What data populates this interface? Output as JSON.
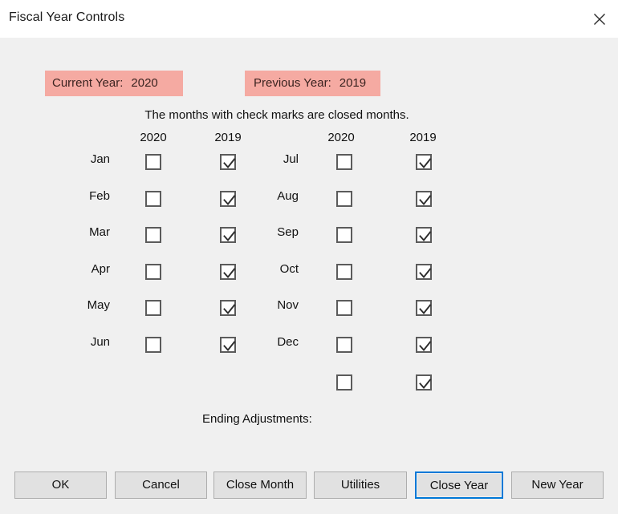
{
  "window": {
    "title": "Fiscal Year Controls",
    "close_icon": "close-icon"
  },
  "header": {
    "current_year_label": "Current Year:",
    "current_year_value": "2020",
    "previous_year_label": "Previous Year:",
    "previous_year_value": "2019",
    "highlight_color": "#f5aaa2",
    "instruction": "The months with check marks are closed months."
  },
  "grid": {
    "column_headers": [
      "2020",
      "2019",
      "2020",
      "2019"
    ],
    "left_rows": [
      {
        "month": "Jan",
        "current_checked": false,
        "previous_checked": true
      },
      {
        "month": "Feb",
        "current_checked": false,
        "previous_checked": true
      },
      {
        "month": "Mar",
        "current_checked": false,
        "previous_checked": true
      },
      {
        "month": "Apr",
        "current_checked": false,
        "previous_checked": true
      },
      {
        "month": "May",
        "current_checked": false,
        "previous_checked": true
      },
      {
        "month": "Jun",
        "current_checked": false,
        "previous_checked": true
      }
    ],
    "right_rows": [
      {
        "month": "Jul",
        "current_checked": false,
        "previous_checked": true
      },
      {
        "month": "Aug",
        "current_checked": false,
        "previous_checked": true
      },
      {
        "month": "Sep",
        "current_checked": false,
        "previous_checked": true
      },
      {
        "month": "Oct",
        "current_checked": false,
        "previous_checked": true
      },
      {
        "month": "Nov",
        "current_checked": false,
        "previous_checked": true
      },
      {
        "month": "Dec",
        "current_checked": false,
        "previous_checked": true
      }
    ],
    "ending_adjustments": {
      "label": "Ending Adjustments:",
      "current_checked": false,
      "previous_checked": true
    }
  },
  "buttons": [
    {
      "label": "OK",
      "focused": false
    },
    {
      "label": "Cancel",
      "focused": false
    },
    {
      "label": "Close Month",
      "focused": false
    },
    {
      "label": "Utilities",
      "focused": false
    },
    {
      "label": "Close Year",
      "focused": true
    },
    {
      "label": "New Year",
      "focused": false
    }
  ],
  "colors": {
    "dialog_background": "#f0f0f0",
    "titlebar_background": "#ffffff",
    "focus_border": "#0078d7",
    "checkbox_border": "#5b5b5b"
  }
}
